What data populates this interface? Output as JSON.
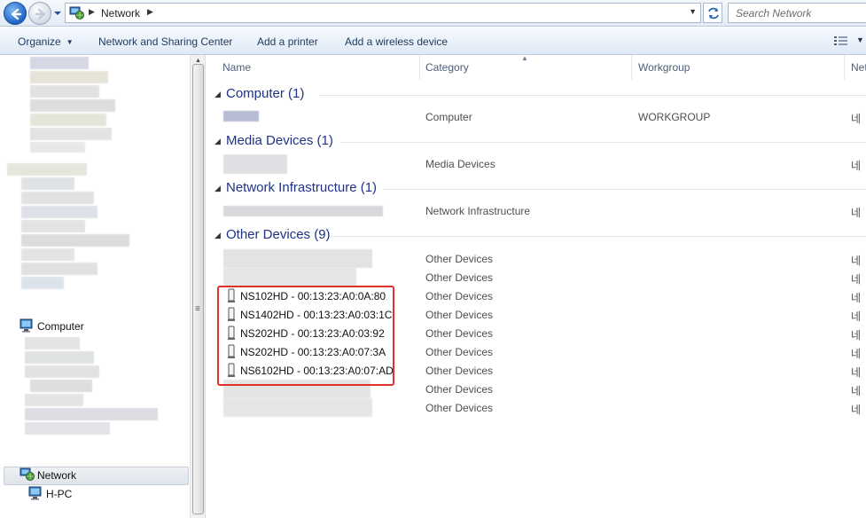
{
  "address_bar": {
    "breadcrumb": [
      "Network"
    ],
    "search_placeholder": "Search Network"
  },
  "command_bar": {
    "items": [
      {
        "label": "Organize",
        "has_dropdown": true
      },
      {
        "label": "Network and Sharing Center"
      },
      {
        "label": "Add a printer"
      },
      {
        "label": "Add a wireless device"
      }
    ]
  },
  "nav_pane": {
    "items": [
      {
        "label": "Computer",
        "icon": "computer-icon"
      },
      {
        "label": "Network",
        "icon": "network-icon",
        "selected": true
      },
      {
        "label": "H-PC",
        "icon": "computer-icon"
      }
    ]
  },
  "columns": [
    "Name",
    "Category",
    "Workgroup",
    "Net"
  ],
  "groups": [
    {
      "title": "Computer (1)",
      "rows": [
        {
          "name": "",
          "category": "Computer",
          "workgroup": "WORKGROUP",
          "net": "네"
        }
      ]
    },
    {
      "title": "Media Devices (1)",
      "rows": [
        {
          "name": "",
          "category": "Media Devices",
          "workgroup": "",
          "net": "네"
        }
      ]
    },
    {
      "title": "Network Infrastructure (1)",
      "rows": [
        {
          "name": "",
          "category": "Network Infrastructure",
          "workgroup": "",
          "net": "네"
        }
      ]
    },
    {
      "title": "Other Devices (9)",
      "rows": [
        {
          "name": "",
          "category": "Other Devices",
          "workgroup": "",
          "net": "네"
        },
        {
          "name": "",
          "category": "Other Devices",
          "workgroup": "",
          "net": "네"
        },
        {
          "name": "NS102HD - 00:13:23:A0:0A:80",
          "category": "Other Devices",
          "workgroup": "",
          "net": "네"
        },
        {
          "name": "NS1402HD - 00:13:23:A0:03:1C",
          "category": "Other Devices",
          "workgroup": "",
          "net": "네"
        },
        {
          "name": "NS202HD - 00:13:23:A0:03:92",
          "category": "Other Devices",
          "workgroup": "",
          "net": "네"
        },
        {
          "name": "NS202HD - 00:13:23:A0:07:3A",
          "category": "Other Devices",
          "workgroup": "",
          "net": "네"
        },
        {
          "name": "NS6102HD - 00:13:23:A0:07:AD",
          "category": "Other Devices",
          "workgroup": "",
          "net": "네"
        },
        {
          "name": "",
          "category": "Other Devices",
          "workgroup": "",
          "net": "네"
        },
        {
          "name": "",
          "category": "Other Devices",
          "workgroup": "",
          "net": "네"
        }
      ]
    }
  ],
  "colors": {
    "group_title": "#1e3287",
    "highlight": "#e0312b",
    "command_text": "#1e395b"
  }
}
